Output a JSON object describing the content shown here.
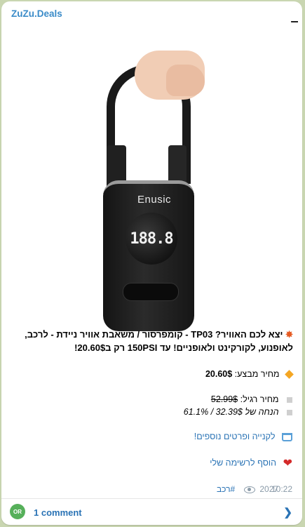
{
  "channel": {
    "name": "ZuZu.Deals"
  },
  "product_image": {
    "brand": "Enusic",
    "display": "188.8"
  },
  "post": {
    "caption": "יצא לכם האוויר? TP03 - קומפרסור / משאבת אוויר ניידת - לרכב, לאופנוע, לקורקינט ולאופניים! עד 150PSI רק ב20.60$!",
    "sale_price_label": "מחיר מבצע:",
    "sale_price": "20.60$",
    "regular_price_label": "מחיר רגיל:",
    "regular_price": "52.99$",
    "discount_text": "הנחה של 32.39$ / 61.1%",
    "buy_link": "לקנייה ופרטים נוספים!",
    "wishlist_link": "הוסף לרשימה שלי",
    "hashtag": "#רכב",
    "views": "2027",
    "time": "10:22"
  },
  "comments": {
    "avatar_initials": "OR",
    "label": "1 comment"
  },
  "colors": {
    "link": "#2a73b5",
    "background": "#c9d6b1",
    "accent": "#3a8bc8"
  },
  "icons": [
    "collision-icon",
    "diamond-icon",
    "square-icon",
    "cart-icon",
    "heart-icon",
    "eye-icon",
    "chevron-right-icon"
  ]
}
